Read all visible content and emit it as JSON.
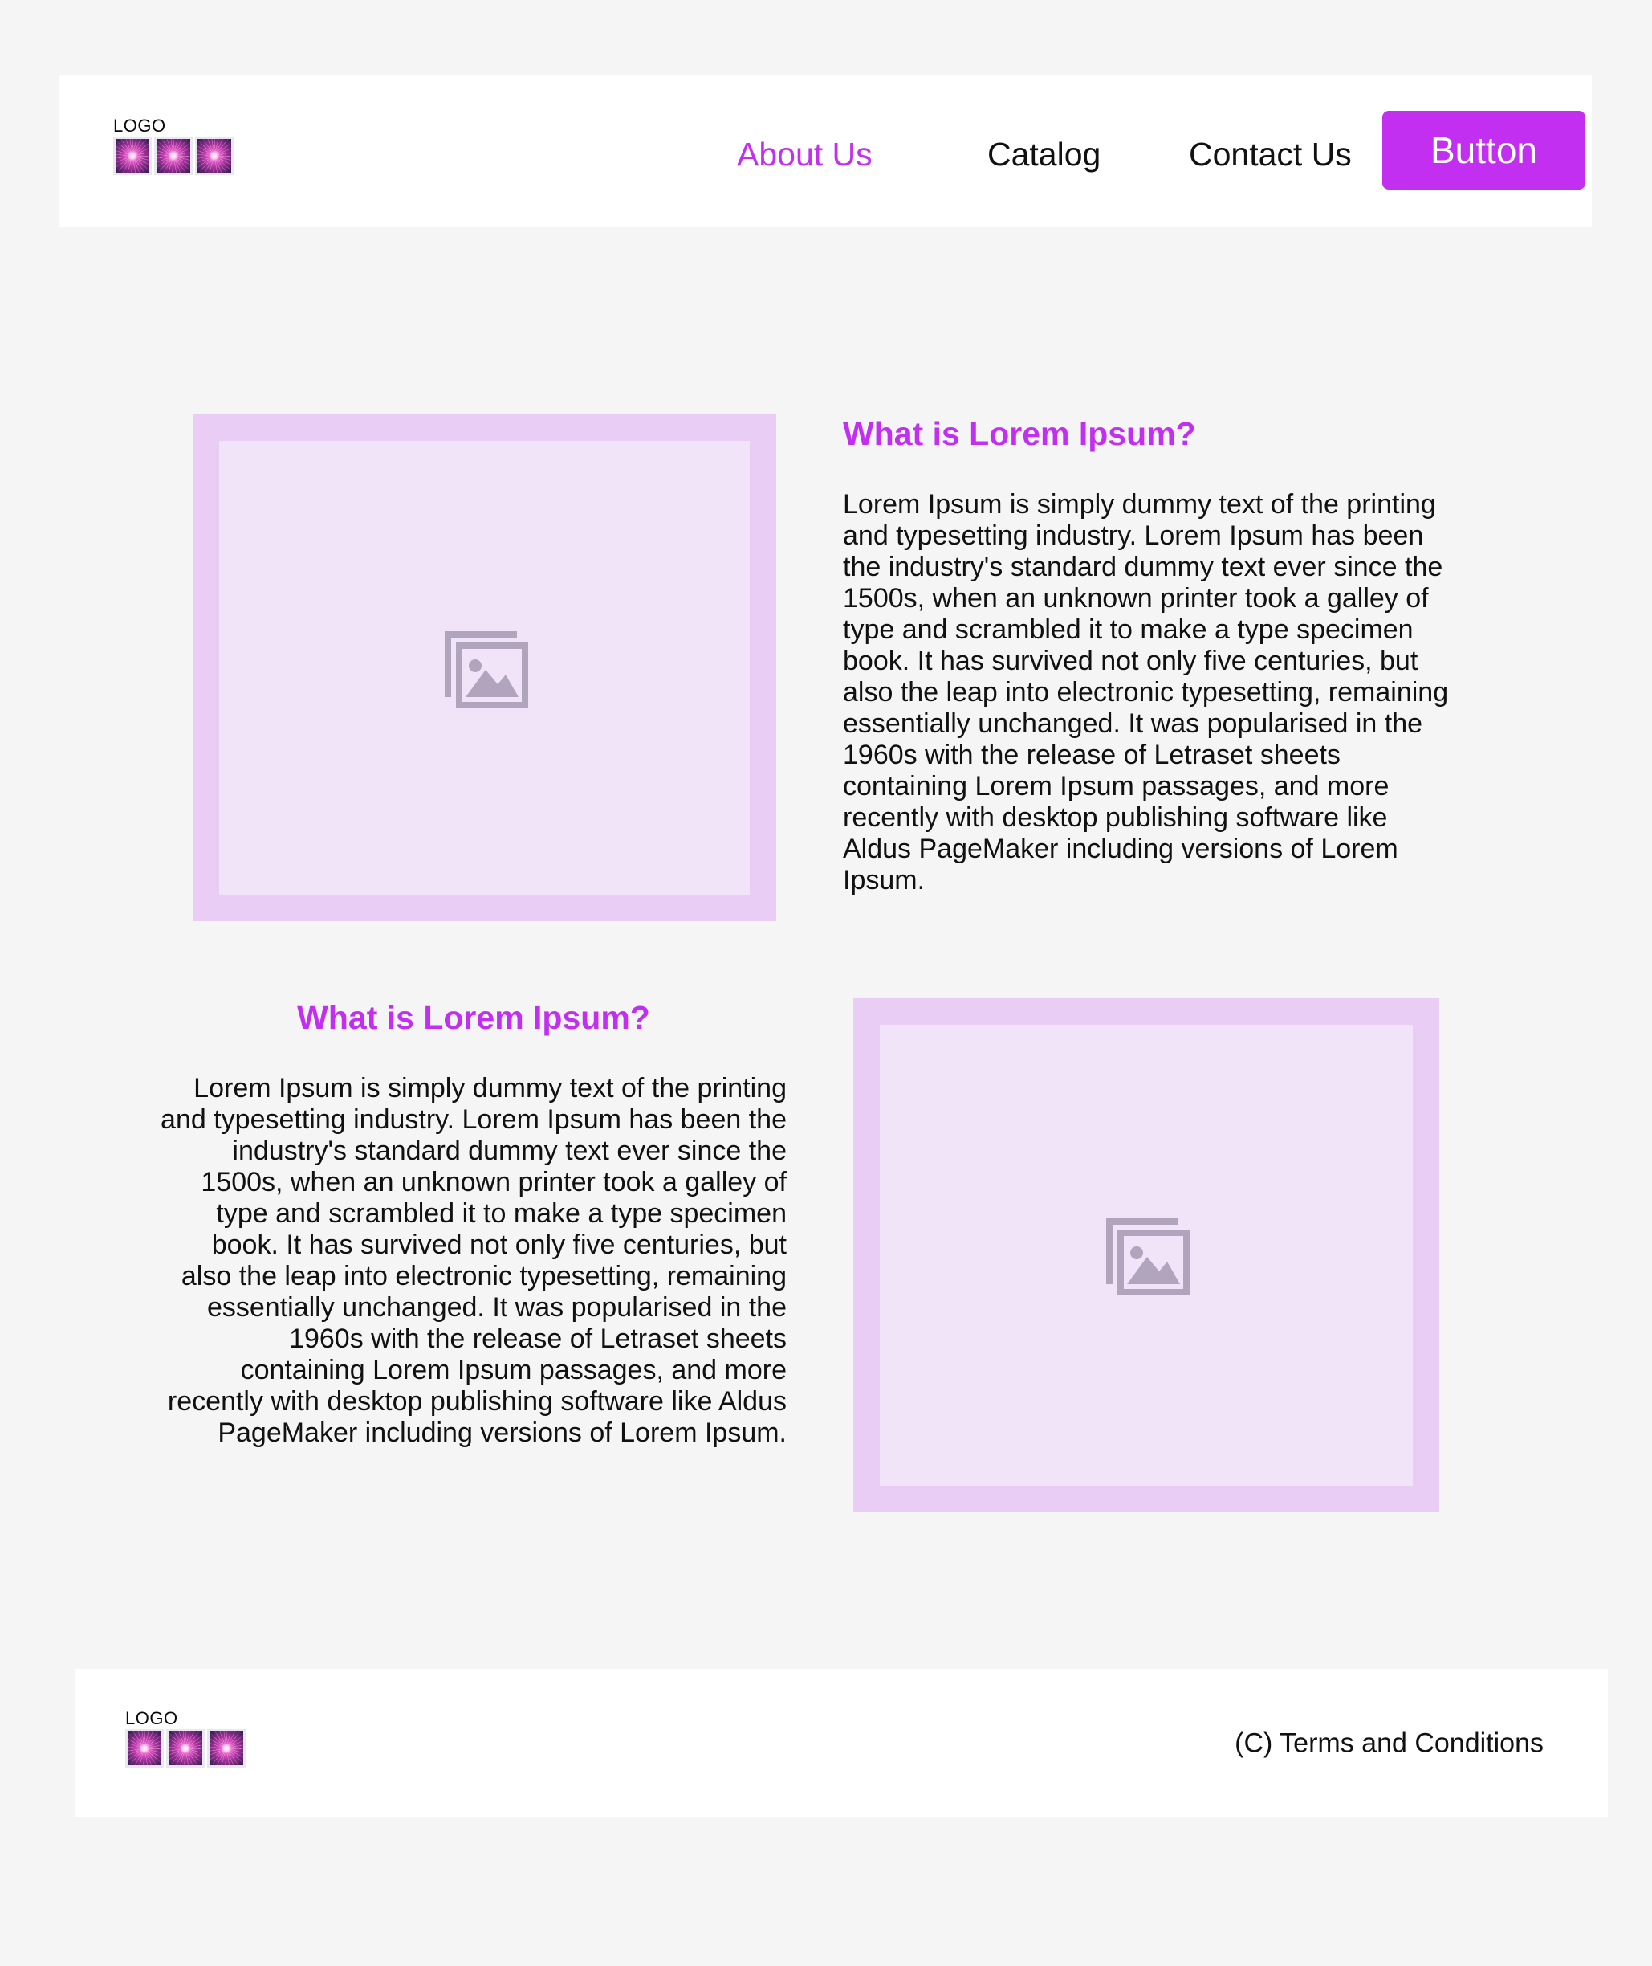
{
  "header": {
    "logo": {
      "text": "LOGO",
      "icon_name": "firework-sparkle-image",
      "icon_count": 3
    },
    "nav": [
      {
        "label": "About Us",
        "active": true
      },
      {
        "label": "Catalog",
        "active": false
      },
      {
        "label": "Contact Us",
        "active": false
      }
    ],
    "button": {
      "label": "Button"
    }
  },
  "sections": [
    {
      "layout": "image-left",
      "image": {
        "placeholder_icon": "image-placeholder-icon"
      },
      "heading": "What is Lorem Ipsum?",
      "body": "Lorem Ipsum is simply dummy text of the printing and typesetting industry. Lorem Ipsum has been the industry's standard dummy text ever since the 1500s, when an unknown printer took a galley of type and scrambled it to make a type specimen book. It has survived not only five centuries, but also the leap into electronic typesetting, remaining essentially unchanged. It was popularised in the 1960s with the release of Letraset sheets containing Lorem Ipsum passages, and more recently with desktop publishing software like Aldus PageMaker including versions of Lorem Ipsum.",
      "text_align": "left"
    },
    {
      "layout": "image-right",
      "image": {
        "placeholder_icon": "image-placeholder-icon"
      },
      "heading": "What is Lorem Ipsum?",
      "body": "Lorem Ipsum is simply dummy text of the printing and typesetting industry. Lorem Ipsum has been the industry's standard dummy text ever since the 1500s, when an unknown printer took a galley of type and scrambled it to make a type specimen book. It has survived not only five centuries, but also the leap into electronic typesetting, remaining essentially unchanged. It was popularised in the 1960s with the release of Letraset sheets containing Lorem Ipsum passages, and more recently with desktop publishing software like Aldus PageMaker including versions of Lorem Ipsum.",
      "text_align": "right"
    }
  ],
  "footer": {
    "logo": {
      "text": "LOGO",
      "icon_name": "firework-sparkle-image",
      "icon_count": 3
    },
    "terms": "(C) Terms and Conditions"
  },
  "colors": {
    "page_background": "#f5f5f5",
    "surface": "#ffffff",
    "accent": "#c32ff0",
    "text": "#111111",
    "placeholder_outer": "#e9cdf4",
    "placeholder_inner": "#f1e3f8",
    "placeholder_icon": "#b1a4bd"
  }
}
